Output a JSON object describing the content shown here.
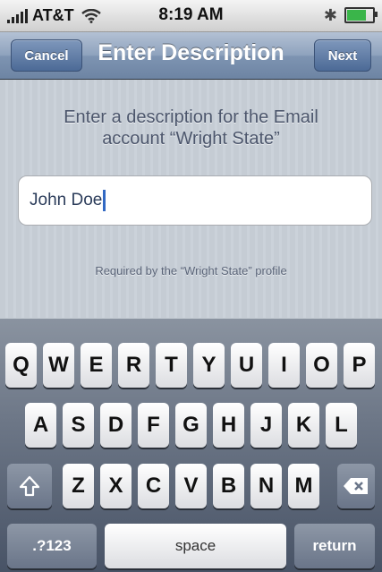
{
  "status": {
    "carrier": "AT&T",
    "time": "8:19 AM",
    "icons": [
      "signal-bars-icon",
      "wifi-icon",
      "bluetooth-icon",
      "battery-icon"
    ],
    "battery_level": 0.8
  },
  "nav": {
    "cancel_label": "Cancel",
    "title": "Enter Description",
    "next_label": "Next"
  },
  "content": {
    "prompt_line1": "Enter a description for the Email",
    "prompt_line2": "account “Wright State”",
    "field_value": "John Doe",
    "footnote": "Required by the “Wright State” profile"
  },
  "keyboard": {
    "row1": [
      "Q",
      "W",
      "E",
      "R",
      "T",
      "Y",
      "U",
      "I",
      "O",
      "P"
    ],
    "row2": [
      "A",
      "S",
      "D",
      "F",
      "G",
      "H",
      "J",
      "K",
      "L"
    ],
    "row3": [
      "Z",
      "X",
      "C",
      "V",
      "B",
      "N",
      "M"
    ],
    "shift_icon": "shift-arrow-icon",
    "delete_icon": "backspace-icon",
    "numbers_label": ".?123",
    "space_label": "space",
    "return_label": "return"
  }
}
